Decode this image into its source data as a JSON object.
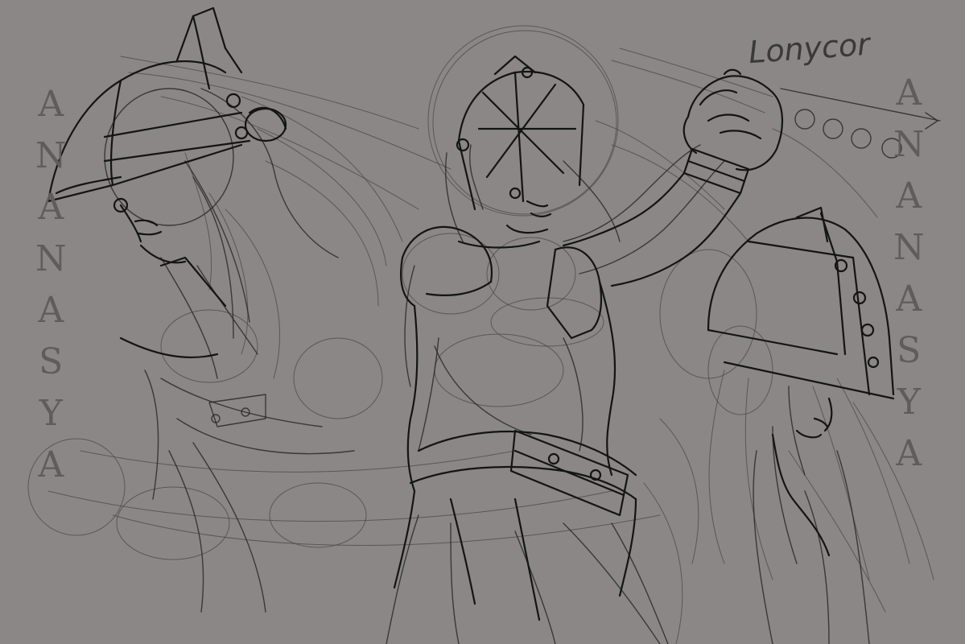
{
  "watermark": {
    "left_text": "ANANASYA",
    "right_text": "ANANASYA"
  },
  "signature": {
    "text": "Lonycor"
  },
  "colors": {
    "background": "#8a8786",
    "stroke": "#1e1e1e",
    "watermark": "#5e5c5c"
  }
}
